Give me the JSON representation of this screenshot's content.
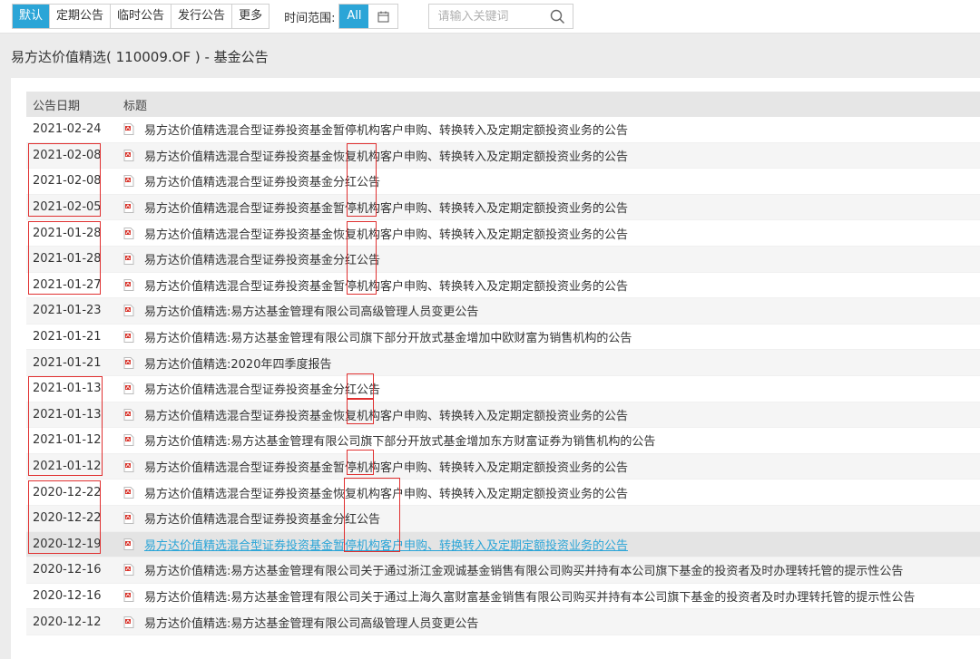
{
  "filters": {
    "tabs": [
      {
        "label": "默认",
        "active": true
      },
      {
        "label": "定期公告",
        "active": false
      },
      {
        "label": "临时公告",
        "active": false
      },
      {
        "label": "发行公告",
        "active": false
      },
      {
        "label": "更多",
        "active": false
      }
    ],
    "time_label": "时间范围:",
    "time_all": "All",
    "search_placeholder": "请输入关键词"
  },
  "page_title": "易方达价值精选( 110009.OF ) - 基金公告",
  "table": {
    "col_date": "公告日期",
    "col_title": "标题",
    "rows": [
      {
        "date": "2021-02-24",
        "title": "易方达价值精选混合型证券投资基金暂停机构客户申购、转换转入及定期定额投资业务的公告"
      },
      {
        "date": "2021-02-08",
        "title": "易方达价值精选混合型证券投资基金恢复机构客户申购、转换转入及定期定额投资业务的公告"
      },
      {
        "date": "2021-02-08",
        "title": "易方达价值精选混合型证券投资基金分红公告"
      },
      {
        "date": "2021-02-05",
        "title": "易方达价值精选混合型证券投资基金暂停机构客户申购、转换转入及定期定额投资业务的公告"
      },
      {
        "date": "2021-01-28",
        "title": "易方达价值精选混合型证券投资基金恢复机构客户申购、转换转入及定期定额投资业务的公告"
      },
      {
        "date": "2021-01-28",
        "title": "易方达价值精选混合型证券投资基金分红公告"
      },
      {
        "date": "2021-01-27",
        "title": "易方达价值精选混合型证券投资基金暂停机构客户申购、转换转入及定期定额投资业务的公告"
      },
      {
        "date": "2021-01-23",
        "title": "易方达价值精选:易方达基金管理有限公司高级管理人员变更公告"
      },
      {
        "date": "2021-01-21",
        "title": "易方达价值精选:易方达基金管理有限公司旗下部分开放式基金增加中欧财富为销售机构的公告"
      },
      {
        "date": "2021-01-21",
        "title": "易方达价值精选:2020年四季度报告"
      },
      {
        "date": "2021-01-13",
        "title": "易方达价值精选混合型证券投资基金分红公告"
      },
      {
        "date": "2021-01-13",
        "title": "易方达价值精选混合型证券投资基金恢复机构客户申购、转换转入及定期定额投资业务的公告"
      },
      {
        "date": "2021-01-12",
        "title": "易方达价值精选:易方达基金管理有限公司旗下部分开放式基金增加东方财富证券为销售机构的公告"
      },
      {
        "date": "2021-01-12",
        "title": "易方达价值精选混合型证券投资基金暂停机构客户申购、转换转入及定期定额投资业务的公告"
      },
      {
        "date": "2020-12-22",
        "title": "易方达价值精选混合型证券投资基金恢复机构客户申购、转换转入及定期定额投资业务的公告"
      },
      {
        "date": "2020-12-22",
        "title": "易方达价值精选混合型证券投资基金分红公告"
      },
      {
        "date": "2020-12-19",
        "title": "易方达价值精选混合型证券投资基金暂停机构客户申购、转换转入及定期定额投资业务的公告"
      },
      {
        "date": "2020-12-16",
        "title": "易方达价值精选:易方达基金管理有限公司关于通过浙江金观诚基金销售有限公司购买并持有本公司旗下基金的投资者及时办理转托管的提示性公告"
      },
      {
        "date": "2020-12-16",
        "title": "易方达价值精选:易方达基金管理有限公司关于通过上海久富财富基金销售有限公司购买并持有本公司旗下基金的投资者及时办理转托管的提示性公告"
      },
      {
        "date": "2020-12-12",
        "title": "易方达价值精选:易方达基金管理有限公司高级管理人员变更公告"
      }
    ]
  },
  "colors": {
    "accent": "#2ba5d7",
    "annotation": "#e03030",
    "pdf": "#d9342b"
  }
}
